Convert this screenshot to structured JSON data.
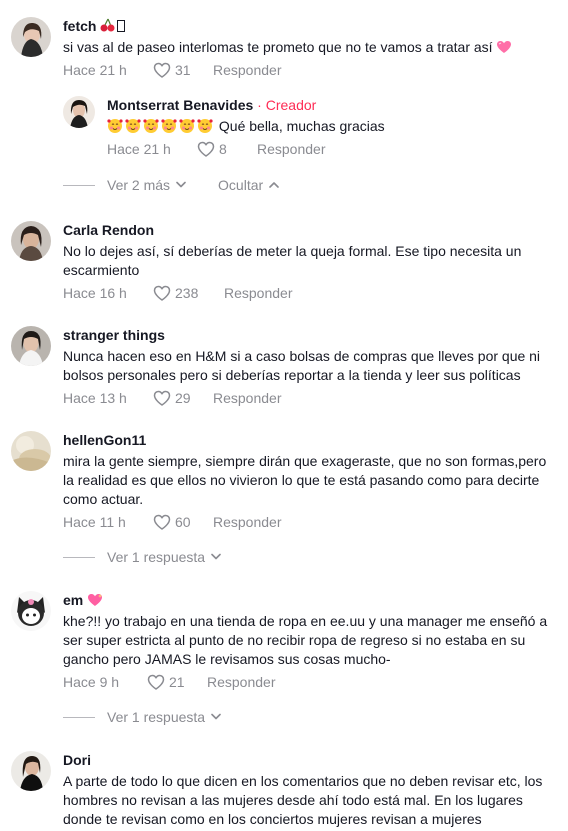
{
  "comments": [
    {
      "username": "fetch",
      "text": "si vas al de paseo interlomas te prometo que no te vamos a tratar así",
      "time": "Hace 21 h",
      "likes": "31",
      "reply_label": "Responder"
    },
    {
      "username": "Montserrat Benavides",
      "creator_dot": " · ",
      "creator_label": "Creador",
      "text": "Qué bella, muchas gracias",
      "time": "Hace 21 h",
      "likes": "8",
      "reply_label": "Responder"
    },
    {
      "username": "Carla Rendon",
      "text": "No lo dejes así, sí deberías de meter la queja formal. Ese tipo necesita un escarmiento",
      "time": "Hace 16 h",
      "likes": "238",
      "reply_label": "Responder"
    },
    {
      "username": "stranger things",
      "text": "Nunca hacen eso en H&M si a caso bolsas de compras que lleves por que ni bolsos personales pero si deberías reportar a la tienda y leer sus políticas",
      "time": "Hace 13 h",
      "likes": "29",
      "reply_label": "Responder"
    },
    {
      "username": "hellenGon11",
      "text": "mira la gente siempre, siempre dirán que exageraste, que no son formas,pero la realidad es que ellos no vivieron lo que te está pasando como para decirte como actuar.",
      "time": "Hace 11 h",
      "likes": "60",
      "reply_label": "Responder"
    },
    {
      "username": "em",
      "text": "khe?!! yo trabajo en una tienda de ropa en ee.uu y una manager me enseñó a ser super estricta al punto de no recibir ropa de regreso si no estaba en su gancho pero JAMAS le revisamos sus cosas mucho-",
      "time": "Hace 9 h",
      "likes": "21",
      "reply_label": "Responder"
    },
    {
      "username": "Dori",
      "text": "A parte de todo lo que dicen en los comentarios que no deben revisar etc, los hombres no revisan a las mujeres desde ahí todo está mal. En los lugares donde te revisan como en los conciertos mujeres revisan a mujeres"
    }
  ],
  "thread_controls": {
    "view_more": "Ver 2 más",
    "hide": "Ocultar",
    "view_reply_1": "Ver 1 respuesta",
    "view_reply_2": "Ver 1 respuesta"
  },
  "colors": {
    "creator": "#fe2c55",
    "secondary_text": "#8a8b91",
    "primary_text": "#161823"
  }
}
